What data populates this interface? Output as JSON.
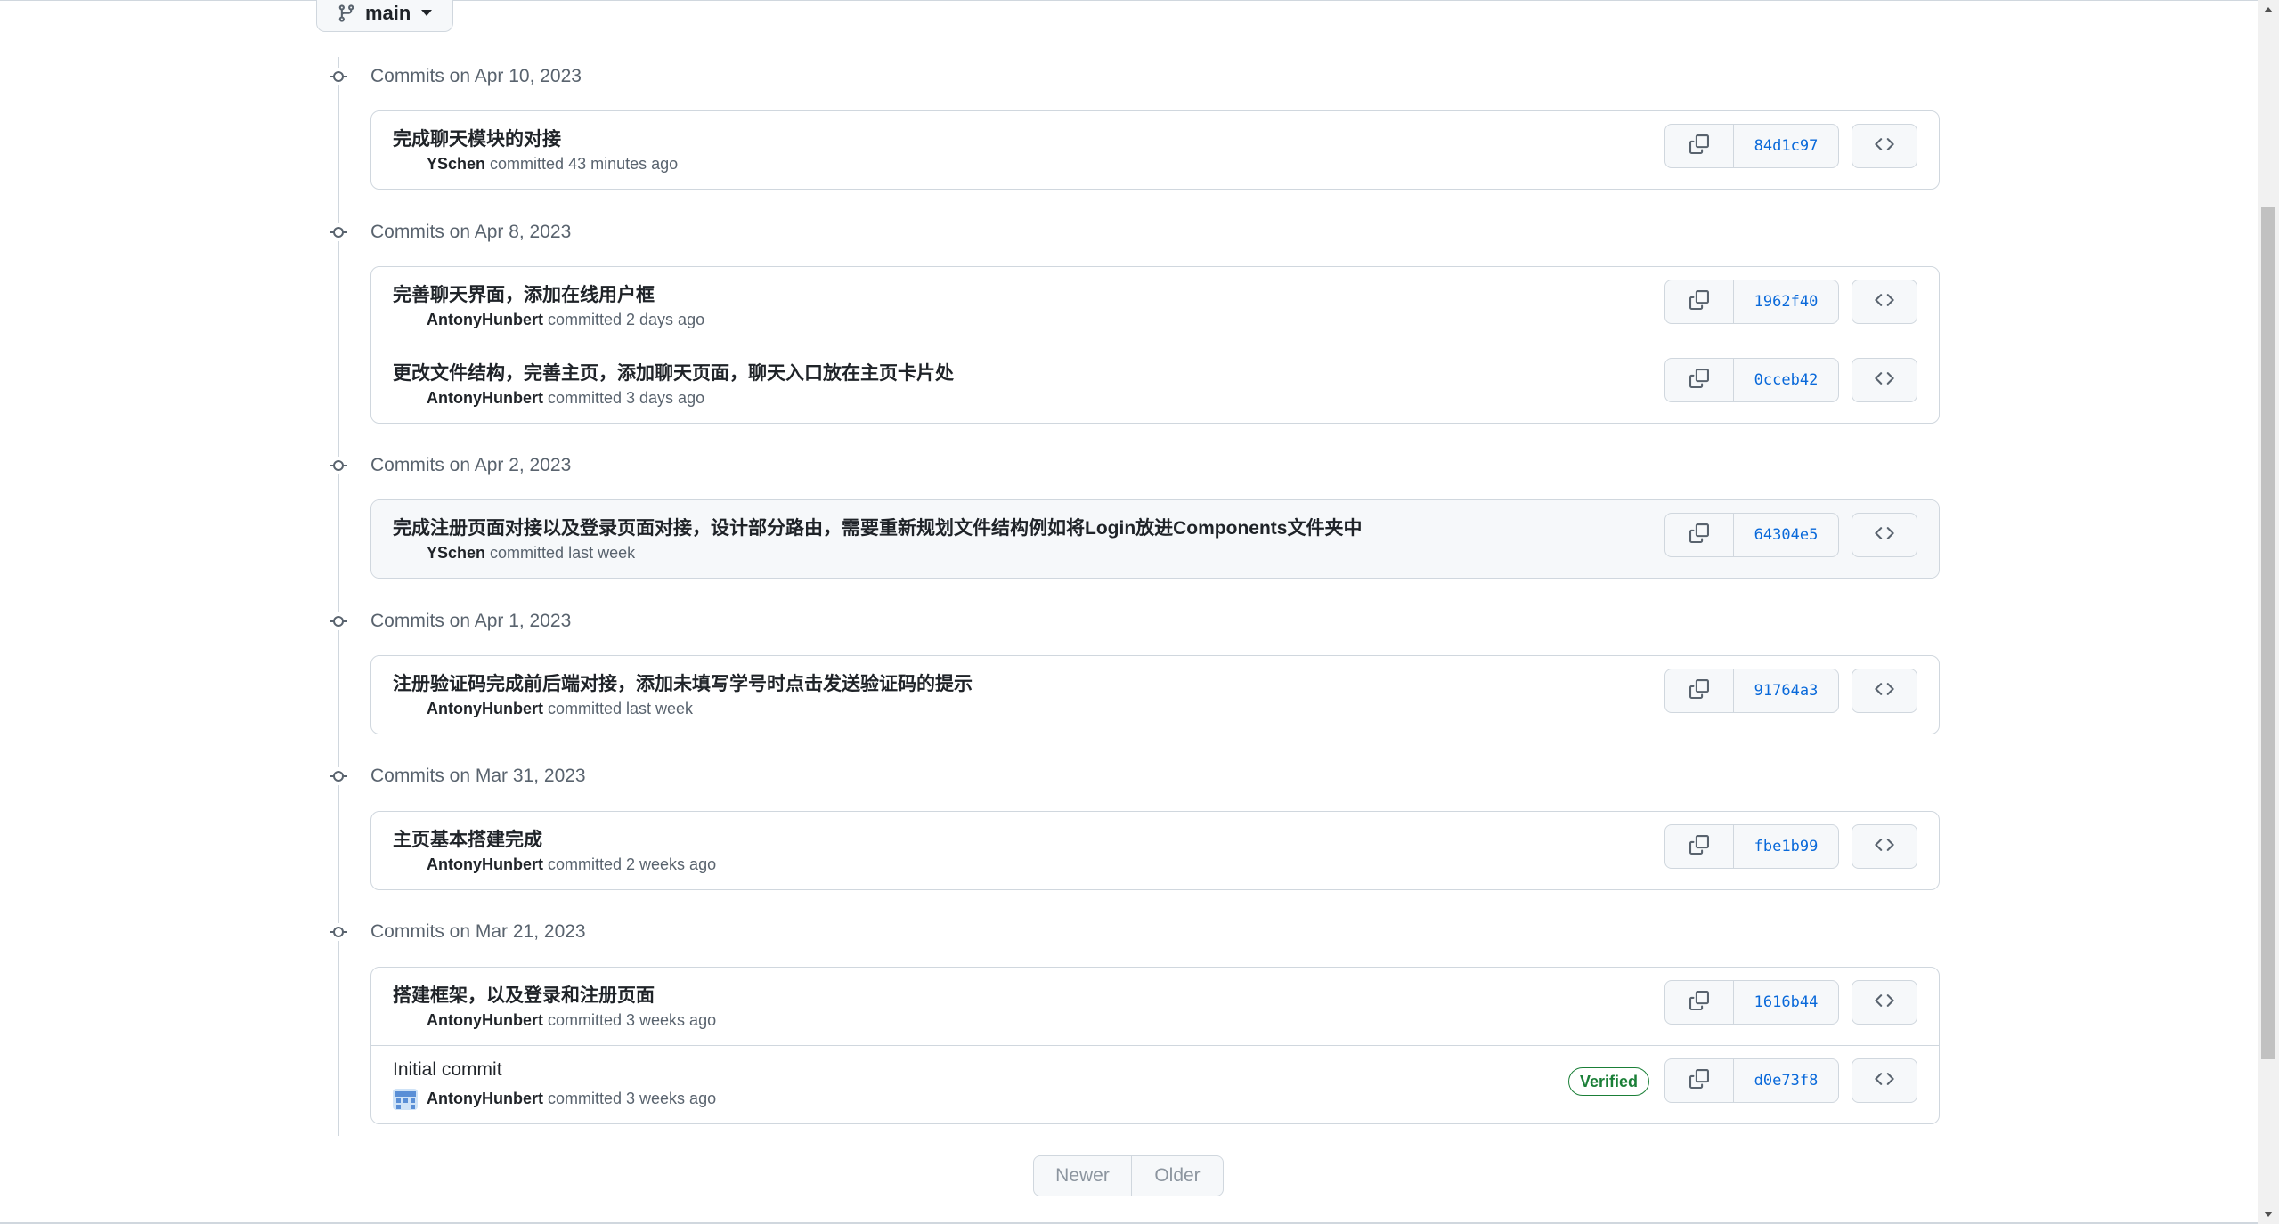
{
  "branch": {
    "label": "main"
  },
  "groups": [
    {
      "title": "Commits on Apr 10, 2023",
      "commits": [
        {
          "message": "完成聊天模块的对接",
          "author": "YSchen",
          "time": "committed 43 minutes ago",
          "sha": "84d1c97"
        }
      ]
    },
    {
      "title": "Commits on Apr 8, 2023",
      "commits": [
        {
          "message": "完善聊天界面，添加在线用户框",
          "author": "AntonyHunbert",
          "time": "committed 2 days ago",
          "sha": "1962f40"
        },
        {
          "message": "更改文件结构，完善主页，添加聊天页面，聊天入口放在主页卡片处",
          "author": "AntonyHunbert",
          "time": "committed 3 days ago",
          "sha": "0cceb42"
        }
      ]
    },
    {
      "title": "Commits on Apr 2, 2023",
      "commits": [
        {
          "message": "完成注册页面对接以及登录页面对接，设计部分路由，需要重新规划文件结构例如将Login放进Components文件夹中",
          "author": "YSchen",
          "time": "committed last week",
          "sha": "64304e5"
        }
      ]
    },
    {
      "title": "Commits on Apr 1, 2023",
      "commits": [
        {
          "message": "注册验证码完成前后端对接，添加未填写学号时点击发送验证码的提示",
          "author": "AntonyHunbert",
          "time": "committed last week",
          "sha": "91764a3"
        }
      ]
    },
    {
      "title": "Commits on Mar 31, 2023",
      "commits": [
        {
          "message": "主页基本搭建完成",
          "author": "AntonyHunbert",
          "time": "committed 2 weeks ago",
          "sha": "fbe1b99"
        }
      ]
    },
    {
      "title": "Commits on Mar 21, 2023",
      "commits": [
        {
          "message": "搭建框架，以及登录和注册页面",
          "author": "AntonyHunbert",
          "time": "committed 3 weeks ago",
          "sha": "1616b44"
        },
        {
          "message": "Initial commit",
          "author": "AntonyHunbert",
          "time": "committed 3 weeks ago",
          "sha": "d0e73f8",
          "badge": "Verified"
        }
      ]
    }
  ],
  "pagination": {
    "newer": "Newer",
    "older": "Older"
  },
  "icons": {
    "branch": "git-branch-icon",
    "commit": "git-commit-icon",
    "copy": "copy-icon",
    "browse": "code-icon"
  },
  "colors": {
    "link": "#0969da",
    "muted": "#59636e",
    "border": "#d0d7de",
    "verified": "#1a7f37"
  }
}
